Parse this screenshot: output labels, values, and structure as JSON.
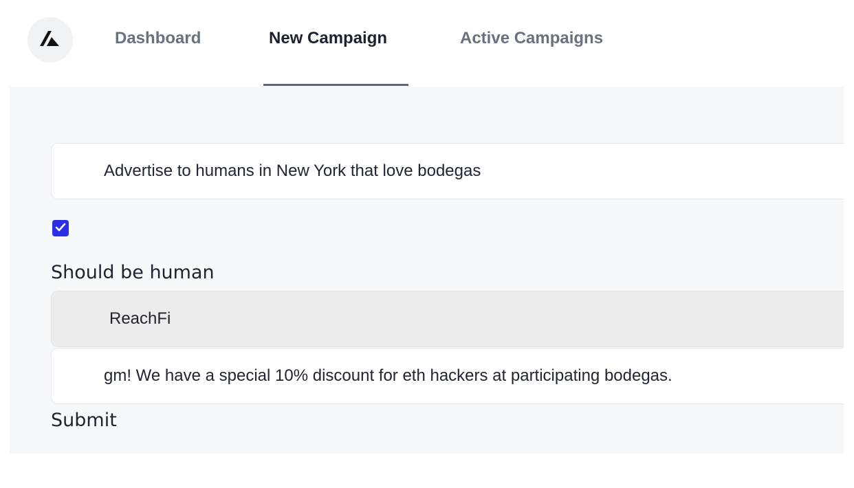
{
  "nav": {
    "logo_icon": "reachfi-logo-icon",
    "tabs": [
      {
        "label": "Dashboard",
        "active": false
      },
      {
        "label": "New Campaign",
        "active": true
      },
      {
        "label": "Active Campaigns",
        "active": false
      }
    ]
  },
  "form": {
    "audience_value": "Advertise to humans in New York that love bodegas",
    "should_be_human_checked": true,
    "should_be_human_label": "Should be human",
    "sender_value": "ReachFi",
    "message_value": "gm! We have a special 10% discount for eth hackers at participating bodegas.",
    "submit_label": "Submit"
  },
  "colors": {
    "accent": "#2c2fe6",
    "tab_active": "#1d2030",
    "tab_inactive": "#6b7080",
    "panel_bg": "#f7f8fa"
  }
}
